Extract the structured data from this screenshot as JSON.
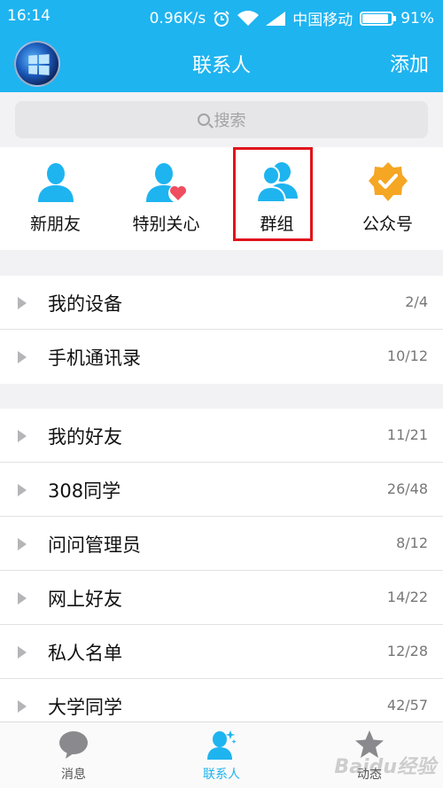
{
  "status_bar": {
    "time": "16:14",
    "speed": "0.96K/s",
    "carrier": "中国移动",
    "battery_label": "91%",
    "battery_level": 0.91
  },
  "header": {
    "title": "联系人",
    "add_label": "添加"
  },
  "search": {
    "placeholder": "搜索"
  },
  "quick_actions": [
    {
      "label": "新朋友",
      "icon": "person-icon"
    },
    {
      "label": "特别关心",
      "icon": "person-heart-icon"
    },
    {
      "label": "群组",
      "icon": "group-icon"
    },
    {
      "label": "公众号",
      "icon": "verified-badge-icon"
    }
  ],
  "sections": [
    {
      "rows": [
        {
          "name": "我的设备",
          "count": "2/4"
        },
        {
          "name": "手机通讯录",
          "count": "10/12"
        }
      ]
    },
    {
      "rows": [
        {
          "name": "我的好友",
          "count": "11/21"
        },
        {
          "name": "308同学",
          "count": "26/48"
        },
        {
          "name": "问问管理员",
          "count": "8/12"
        },
        {
          "name": "网上好友",
          "count": "14/22"
        },
        {
          "name": "私人名单",
          "count": "12/28"
        },
        {
          "name": "大学同学",
          "count": "42/57"
        }
      ]
    }
  ],
  "tab_bar": {
    "tabs": [
      {
        "label": "消息",
        "icon": "chat-bubble-icon"
      },
      {
        "label": "联系人",
        "icon": "contacts-icon"
      },
      {
        "label": "动态",
        "icon": "star-icon"
      }
    ]
  },
  "colors": {
    "brand": "#1eb4f0",
    "highlight": "#e0141c",
    "heart": "#ef4e5f",
    "badge": "#f5a623"
  },
  "watermark": "Baidu经验"
}
